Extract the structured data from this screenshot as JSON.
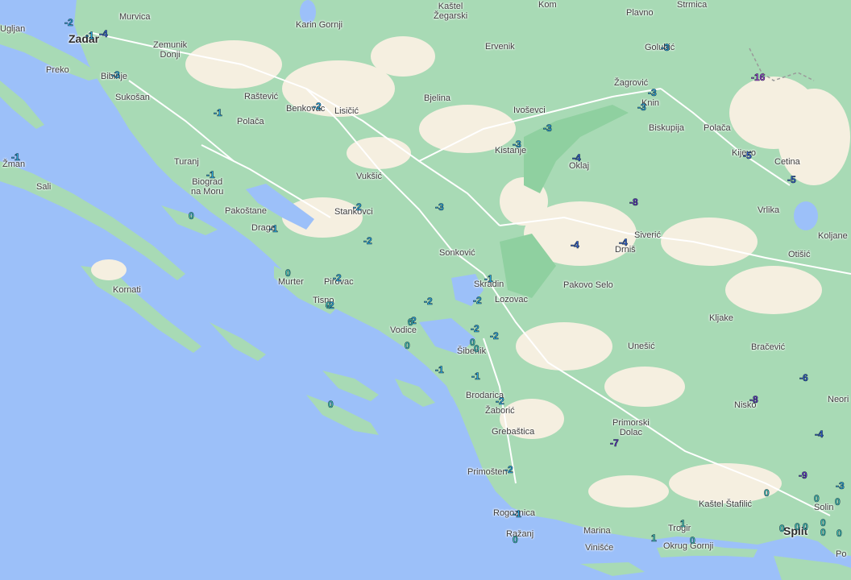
{
  "map": {
    "colors": {
      "sea": "#9cc0f9",
      "land": "#a8dab5",
      "land_light": "#f5efe0",
      "roads": "#ffffff",
      "lakes": "#9cc0f9"
    },
    "places": [
      {
        "id": "kastel-zegarski",
        "label": "Kaštel\nŽegarski",
        "ml": true
      },
      {
        "id": "kom",
        "label": "Kom"
      },
      {
        "id": "plavno",
        "label": "Plavno"
      },
      {
        "id": "strmica",
        "label": "Strmica"
      },
      {
        "id": "ugljan",
        "label": "Ugljan"
      },
      {
        "id": "zadar",
        "label": "Zadar",
        "big": true
      },
      {
        "id": "murvica",
        "label": "Murvica"
      },
      {
        "id": "zemunik",
        "label": "Zemunik\nDonji",
        "ml": true
      },
      {
        "id": "karin",
        "label": "Karin Gornji"
      },
      {
        "id": "ervenik",
        "label": "Ervenik"
      },
      {
        "id": "golubic",
        "label": "Golubić"
      },
      {
        "id": "preko",
        "label": "Preko"
      },
      {
        "id": "bibinje",
        "label": "Bibinje"
      },
      {
        "id": "sukosan",
        "label": "Sukošan"
      },
      {
        "id": "rastevic",
        "label": "Raštević"
      },
      {
        "id": "benkovac",
        "label": "Benkovac"
      },
      {
        "id": "lisicic",
        "label": "Lisičić"
      },
      {
        "id": "bjelina",
        "label": "Bjelina"
      },
      {
        "id": "zagrovic",
        "label": "Žagrović"
      },
      {
        "id": "knin",
        "label": "Knin"
      },
      {
        "id": "polaca1",
        "label": "Polača"
      },
      {
        "id": "ivosevci",
        "label": "Ivoševci"
      },
      {
        "id": "biskupija",
        "label": "Biskupija"
      },
      {
        "id": "polaca2",
        "label": "Polača"
      },
      {
        "id": "kistanje",
        "label": "Kistanje"
      },
      {
        "id": "kijevo",
        "label": "Kijevo"
      },
      {
        "id": "zman",
        "label": "Žman"
      },
      {
        "id": "turanj",
        "label": "Turanj"
      },
      {
        "id": "oklaj",
        "label": "Oklaj"
      },
      {
        "id": "cetina",
        "label": "Cetina"
      },
      {
        "id": "sali",
        "label": "Sali"
      },
      {
        "id": "vuksic",
        "label": "Vukšić"
      },
      {
        "id": "biograd",
        "label": "Biograd\nna Moru",
        "ml": true
      },
      {
        "id": "pakostane",
        "label": "Pakoštane"
      },
      {
        "id": "stankovci",
        "label": "Stankovci"
      },
      {
        "id": "vrlika",
        "label": "Vrlika"
      },
      {
        "id": "drage",
        "label": "Drage"
      },
      {
        "id": "siveric",
        "label": "Siverić"
      },
      {
        "id": "kljane",
        "label": "Koljane"
      },
      {
        "id": "drnis",
        "label": "Drniš"
      },
      {
        "id": "sonkovic",
        "label": "Sonković"
      },
      {
        "id": "otisic",
        "label": "Otišić"
      },
      {
        "id": "murter",
        "label": "Murter"
      },
      {
        "id": "pirovac",
        "label": "Pirovac"
      },
      {
        "id": "skradin",
        "label": "Skradin"
      },
      {
        "id": "kornati",
        "label": "Kornati"
      },
      {
        "id": "pakovo",
        "label": "Pakovo Selo"
      },
      {
        "id": "lozovac",
        "label": "Lozovac"
      },
      {
        "id": "tisno",
        "label": "Tisno"
      },
      {
        "id": "kljake",
        "label": "Kljake"
      },
      {
        "id": "vodice",
        "label": "Vodice"
      },
      {
        "id": "sibenik",
        "label": "Šibenik"
      },
      {
        "id": "unesic",
        "label": "Unešić"
      },
      {
        "id": "bracevic",
        "label": "Bračević"
      },
      {
        "id": "brodarica",
        "label": "Brodarica"
      },
      {
        "id": "neori",
        "label": "Neori"
      },
      {
        "id": "zaboric",
        "label": "Žaborić"
      },
      {
        "id": "nisko",
        "label": "Nisko"
      },
      {
        "id": "primorski",
        "label": "Primorski\nDolac",
        "ml": true
      },
      {
        "id": "grebastica",
        "label": "Grebaštica"
      },
      {
        "id": "primosten",
        "label": "Primošten"
      },
      {
        "id": "kastel-stafilic",
        "label": "Kaštel Štafilić"
      },
      {
        "id": "solin",
        "label": "Solin"
      },
      {
        "id": "rogoznica",
        "label": "Rogoznica"
      },
      {
        "id": "trogir",
        "label": "Trogir"
      },
      {
        "id": "marina",
        "label": "Marina"
      },
      {
        "id": "split",
        "label": "Split",
        "big": true
      },
      {
        "id": "razanj",
        "label": "Ražanj"
      },
      {
        "id": "vinisce",
        "label": "Vinišće"
      },
      {
        "id": "okrug",
        "label": "Okrug Gornji"
      },
      {
        "id": "podstrana",
        "label": "Po"
      }
    ],
    "temperatures": [
      {
        "id": "t1",
        "value": "-2"
      },
      {
        "id": "t2",
        "value": "-1"
      },
      {
        "id": "t3",
        "value": "-4"
      },
      {
        "id": "t4",
        "value": "-3"
      },
      {
        "id": "t5",
        "value": "-3"
      },
      {
        "id": "t6",
        "value": "-1"
      },
      {
        "id": "t7",
        "value": "-2"
      },
      {
        "id": "t8",
        "value": "-1"
      },
      {
        "id": "t9",
        "value": "-1"
      },
      {
        "id": "t10",
        "value": "0"
      },
      {
        "id": "t11",
        "value": "-1"
      },
      {
        "id": "t12",
        "value": "0"
      },
      {
        "id": "t13",
        "value": "-2"
      },
      {
        "id": "t14",
        "value": "-2"
      },
      {
        "id": "t15",
        "value": "0"
      },
      {
        "id": "t16",
        "value": "0"
      },
      {
        "id": "t17",
        "value": "0"
      },
      {
        "id": "t18",
        "value": "-3"
      },
      {
        "id": "t19",
        "value": "-3"
      },
      {
        "id": "t20",
        "value": "-3"
      },
      {
        "id": "t21",
        "value": "-4"
      },
      {
        "id": "t22",
        "value": "-3"
      },
      {
        "id": "t23",
        "value": "-2"
      },
      {
        "id": "t24",
        "value": "-3"
      },
      {
        "id": "t25",
        "value": "-16"
      },
      {
        "id": "t26",
        "value": "-5"
      },
      {
        "id": "t27",
        "value": "-5"
      },
      {
        "id": "t28",
        "value": "-8"
      },
      {
        "id": "t29",
        "value": "-4"
      },
      {
        "id": "t30",
        "value": "-4"
      },
      {
        "id": "t31",
        "value": "-1"
      },
      {
        "id": "t32",
        "value": "-2"
      },
      {
        "id": "t33",
        "value": "-2"
      },
      {
        "id": "t34",
        "value": "-2"
      },
      {
        "id": "t35",
        "value": "-2"
      },
      {
        "id": "t36",
        "value": "-2"
      },
      {
        "id": "t37",
        "value": "-2"
      },
      {
        "id": "t38",
        "value": "0"
      },
      {
        "id": "t39",
        "value": "-1"
      },
      {
        "id": "t40",
        "value": "-1"
      },
      {
        "id": "t41",
        "value": "-2"
      },
      {
        "id": "t42",
        "value": "-6"
      },
      {
        "id": "t43",
        "value": "-8"
      },
      {
        "id": "t44",
        "value": "-4"
      },
      {
        "id": "t45",
        "value": "-7"
      },
      {
        "id": "t46",
        "value": "-2"
      },
      {
        "id": "t47",
        "value": "-9"
      },
      {
        "id": "t48",
        "value": "-3"
      },
      {
        "id": "t49",
        "value": "0"
      },
      {
        "id": "t50",
        "value": "0"
      },
      {
        "id": "t51",
        "value": "0"
      },
      {
        "id": "t52",
        "value": "-1"
      },
      {
        "id": "t53",
        "value": "0"
      },
      {
        "id": "t54",
        "value": "1"
      },
      {
        "id": "t55",
        "value": "1"
      },
      {
        "id": "t56",
        "value": "0"
      },
      {
        "id": "t57",
        "value": "0"
      },
      {
        "id": "t58",
        "value": "0"
      },
      {
        "id": "t59",
        "value": "0"
      },
      {
        "id": "t60",
        "value": "0"
      },
      {
        "id": "t61",
        "value": "0"
      },
      {
        "id": "t62",
        "value": "0"
      },
      {
        "id": "t63",
        "value": "0"
      },
      {
        "id": "t64",
        "value": "0"
      }
    ]
  }
}
